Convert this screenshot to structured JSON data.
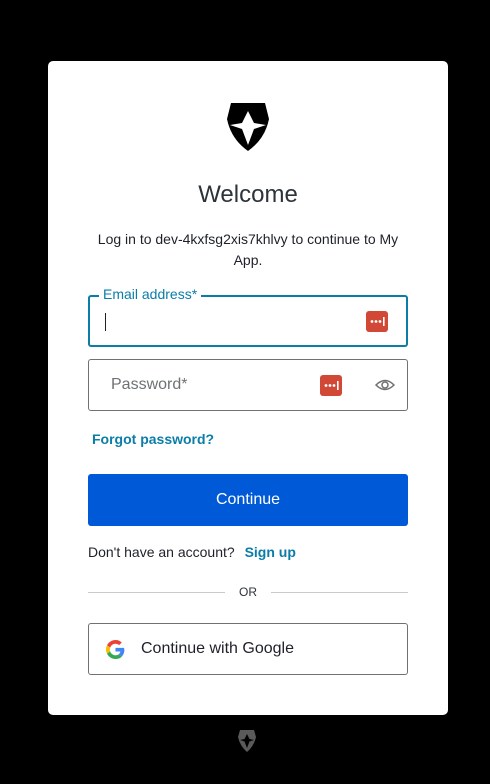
{
  "login": {
    "title": "Welcome",
    "subtitle": "Log in to dev-4kxfsg2xis7khlvy to continue to My App.",
    "email_label": "Email address*",
    "email_value": "",
    "password_placeholder": "Password*",
    "forgot_label": "Forgot password?",
    "continue_label": "Continue",
    "signup_prompt": "Don't have an account?",
    "signup_link": "Sign up",
    "divider_text": "OR",
    "google_label": "Continue with Google"
  },
  "colors": {
    "background": "#000000",
    "card": "#ffffff",
    "accent": "#0a7da8",
    "primary_button": "#0059d6",
    "password_manager_icon": "#d14836"
  },
  "icons": {
    "logo": "shield-logo-icon",
    "email_password_manager": "password-manager-icon",
    "password_password_manager": "password-manager-icon",
    "show_password": "eye-icon",
    "google": "google-g-icon",
    "footer": "shield-logo-icon"
  }
}
